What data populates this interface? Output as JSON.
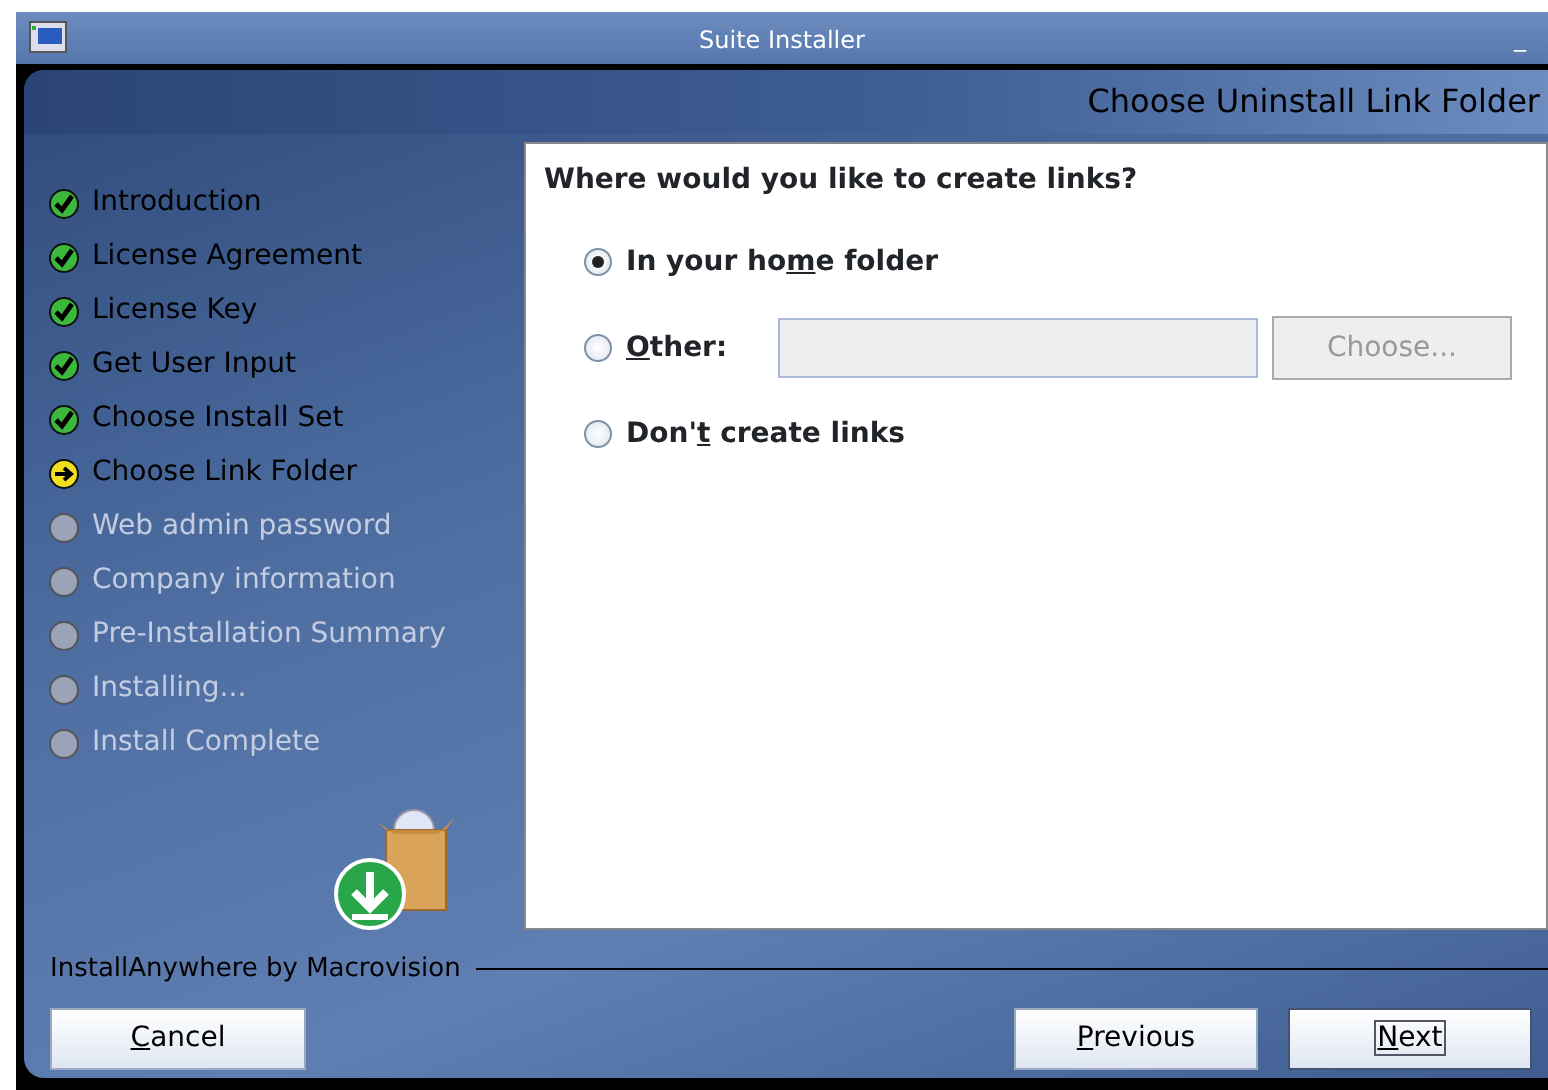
{
  "window": {
    "title": "Suite Installer",
    "controls": [
      "_"
    ]
  },
  "header": {
    "title": "Choose Uninstall Link Folder"
  },
  "steps": [
    {
      "label": "Introduction",
      "kind": "done"
    },
    {
      "label": "License Agreement",
      "kind": "done"
    },
    {
      "label": "License Key",
      "kind": "done"
    },
    {
      "label": "Get User Input",
      "kind": "done"
    },
    {
      "label": "Choose Install Set",
      "kind": "done"
    },
    {
      "label": "Choose Link Folder",
      "kind": "current"
    },
    {
      "label": "Web admin password",
      "kind": "pending"
    },
    {
      "label": "Company information",
      "kind": "pending"
    },
    {
      "label": "Pre-Installation Summary",
      "kind": "pending"
    },
    {
      "label": "Installing...",
      "kind": "pending"
    },
    {
      "label": "Install Complete",
      "kind": "pending"
    }
  ],
  "panel": {
    "question": "Where would you like to create links?",
    "options": [
      {
        "label_parts": [
          {
            "text": "In your ho",
            "underlined": false
          },
          {
            "text": "m",
            "underlined": true
          },
          {
            "text": "e folder",
            "underlined": false
          }
        ],
        "selected": true
      },
      {
        "label_parts": [
          {
            "text": "O",
            "underlined": true
          },
          {
            "text": "ther:",
            "underlined": false
          }
        ],
        "selected": false,
        "field": {
          "disabled": true
        },
        "button": {
          "label": "Choose...",
          "disabled": true
        }
      },
      {
        "label_parts": [
          {
            "text": "Don'",
            "underlined": false
          },
          {
            "text": "t",
            "underlined": true
          },
          {
            "text": " create links",
            "underlined": false
          }
        ],
        "selected": false
      }
    ]
  },
  "branding": "InstallAnywhere by Macrovision",
  "buttons": [
    {
      "label_parts": [
        {
          "text": "C",
          "underlined": true
        },
        {
          "text": "ancel",
          "underlined": false
        }
      ],
      "focused": false
    },
    {
      "label_parts": [
        {
          "text": "P",
          "underlined": true
        },
        {
          "text": "revious",
          "underlined": false
        }
      ],
      "focused": false
    },
    {
      "label_parts": [
        {
          "text": "N",
          "underlined": true
        },
        {
          "text": "ext",
          "underlined": false
        }
      ],
      "focused": true
    }
  ]
}
